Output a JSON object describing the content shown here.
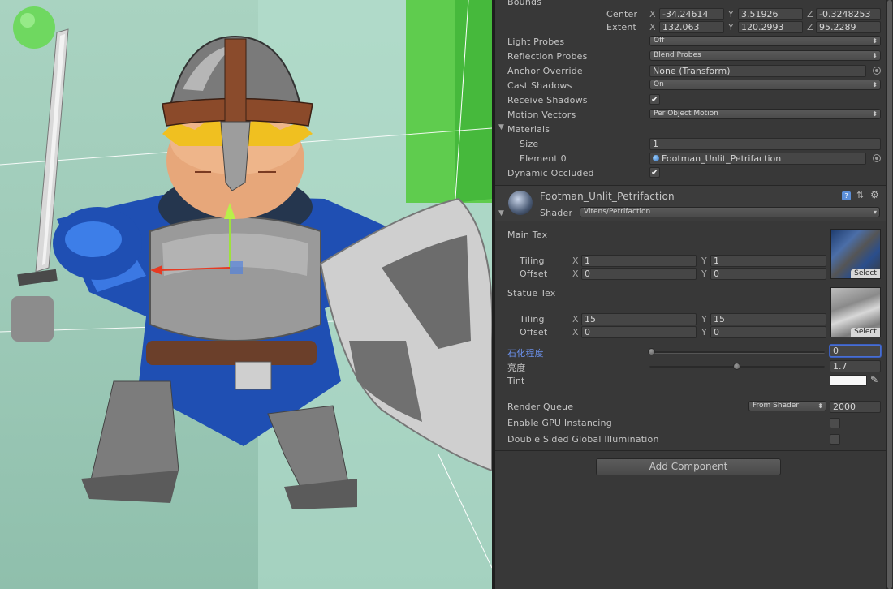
{
  "scene": {
    "description_icons": [
      "sword",
      "helmet",
      "shield",
      "transform-gizmo"
    ]
  },
  "bounds": {
    "label": "Bounds",
    "center_label": "Center",
    "extent_label": "Extent",
    "center": {
      "x": "-34.24614",
      "y": "3.51926",
      "z": "-0.3248253"
    },
    "extent": {
      "x": "132.063",
      "y": "120.2993",
      "z": "95.2289"
    }
  },
  "axes": {
    "x": "X",
    "y": "Y",
    "z": "Z"
  },
  "renderer": {
    "light_probes_label": "Light Probes",
    "light_probes_value": "Off",
    "reflection_probes_label": "Reflection Probes",
    "reflection_probes_value": "Blend Probes",
    "anchor_override_label": "Anchor Override",
    "anchor_override_value": "None (Transform)",
    "cast_shadows_label": "Cast Shadows",
    "cast_shadows_value": "On",
    "receive_shadows_label": "Receive Shadows",
    "receive_shadows_checked": "✔",
    "motion_vectors_label": "Motion Vectors",
    "motion_vectors_value": "Per Object Motion",
    "materials_label": "Materials",
    "size_label": "Size",
    "size_value": "1",
    "element0_label": "Element 0",
    "element0_value": "Footman_Unlit_Petrifaction",
    "dynamic_occluded_label": "Dynamic Occluded",
    "dynamic_occluded_checked": "✔"
  },
  "material": {
    "name": "Footman_Unlit_Petrifaction",
    "shader_label": "Shader",
    "shader_value": "Vitens/Petrifaction",
    "main_tex_label": "Main Tex",
    "statue_tex_label": "Statue Tex",
    "tiling_label": "Tiling",
    "offset_label": "Offset",
    "select_label": "Select",
    "main_tiling": {
      "x": "1",
      "y": "1"
    },
    "main_offset": {
      "x": "0",
      "y": "0"
    },
    "statue_tiling": {
      "x": "15",
      "y": "15"
    },
    "statue_offset": {
      "x": "0",
      "y": "0"
    },
    "petrify_label": "石化程度",
    "petrify_value": "0",
    "petrify_fraction": 0.0,
    "brightness_label": "亮度",
    "brightness_value": "1.7",
    "brightness_fraction": 0.5,
    "tint_label": "Tint",
    "tint_color": "#f7f7f7",
    "render_queue_label": "Render Queue",
    "render_queue_mode": "From Shader",
    "render_queue_value": "2000",
    "gpu_instancing_label": "Enable GPU Instancing",
    "double_sided_gi_label": "Double Sided Global Illumination"
  },
  "add_component_label": "Add Component",
  "colors": {
    "accent_blue": "#6a8fe8",
    "panel": "#383838",
    "field": "#464646"
  }
}
